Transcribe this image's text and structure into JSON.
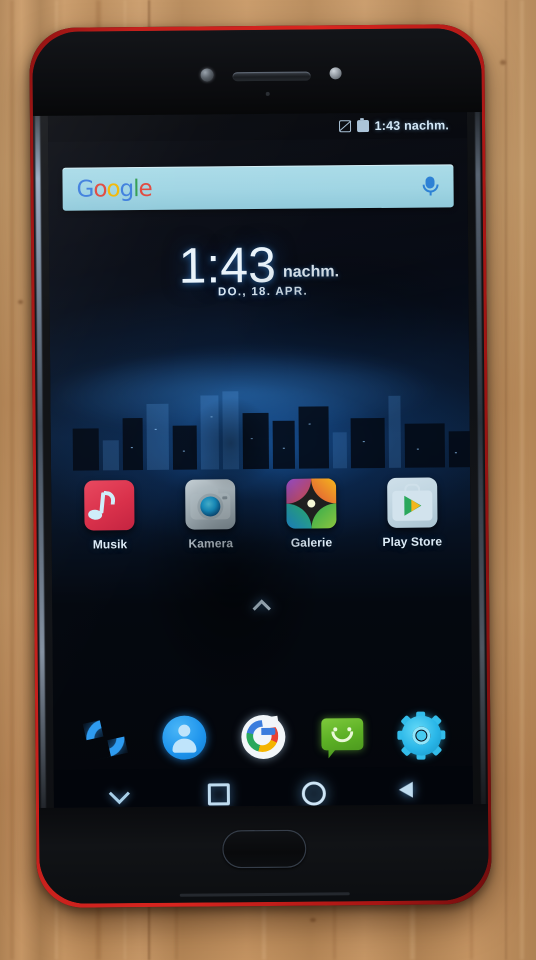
{
  "scene": {
    "description": "smartphone-on-wooden-table-photo",
    "surface": "wooden-plank-table",
    "surface_color": "#c4935f"
  },
  "device": {
    "frame_color": "#101215",
    "bumper_color": "#c4201c",
    "camera_icon": "front-camera",
    "earpiece_icon": "earpiece-speaker",
    "sensor_icon": "proximity-sensor",
    "home_button_label": "home-button"
  },
  "status_bar": {
    "time": "1:43 nachm.",
    "icons": [
      {
        "name": "no-sim-icon",
        "glyph": "nosim"
      },
      {
        "name": "battery-icon",
        "glyph": "battery"
      }
    ]
  },
  "search_widget": {
    "logo_letters": [
      {
        "char": "G",
        "color": "#3b7ddd"
      },
      {
        "char": "o",
        "color": "#e0453a"
      },
      {
        "char": "o",
        "color": "#f3b600"
      },
      {
        "char": "g",
        "color": "#3b7ddd"
      },
      {
        "char": "l",
        "color": "#2e9b4f"
      },
      {
        "char": "e",
        "color": "#e0453a"
      }
    ],
    "logo_text": "Google",
    "placeholder": "Google",
    "mic_icon": "microphone-icon",
    "bar_color": "#9ed4e3"
  },
  "clock_widget": {
    "time": "1:43",
    "meridiem": "nachm.",
    "date": "DO., 18. APR."
  },
  "apps": [
    {
      "label": "Musik",
      "icon": "music-note-icon",
      "color": "#d9304a"
    },
    {
      "label": "Kamera",
      "icon": "camera-icon",
      "color": "#b6c5cd"
    },
    {
      "label": "Galerie",
      "icon": "gallery-pinwheel-icon",
      "color": "#2aa85c"
    },
    {
      "label": "Play Store",
      "icon": "play-store-icon",
      "color": "#cfe0ea"
    }
  ],
  "app_drawer": {
    "affordance_icon": "chevron-up-icon",
    "label": "App-Drawer öffnen"
  },
  "dock": [
    {
      "name": "phone",
      "icon": "phone-handset-icon",
      "color": "#2e9bf0"
    },
    {
      "name": "contacts",
      "icon": "contacts-person-icon",
      "color": "#1d93ec"
    },
    {
      "name": "google",
      "icon": "google-g-icon",
      "color": "#3b7ddd"
    },
    {
      "name": "messages",
      "icon": "messages-bubble-icon",
      "color": "#5cb025"
    },
    {
      "name": "settings",
      "icon": "settings-gear-icon",
      "color": "#29b6e8"
    }
  ],
  "nav_bar": [
    {
      "name": "hide-navbar",
      "icon": "chevron-down-icon"
    },
    {
      "name": "recents",
      "icon": "square-icon"
    },
    {
      "name": "home",
      "icon": "circle-icon"
    },
    {
      "name": "back",
      "icon": "triangle-left-icon"
    }
  ],
  "wallpaper": {
    "subject": "night-city-skyline",
    "glow_color": "#1e6ec8"
  }
}
